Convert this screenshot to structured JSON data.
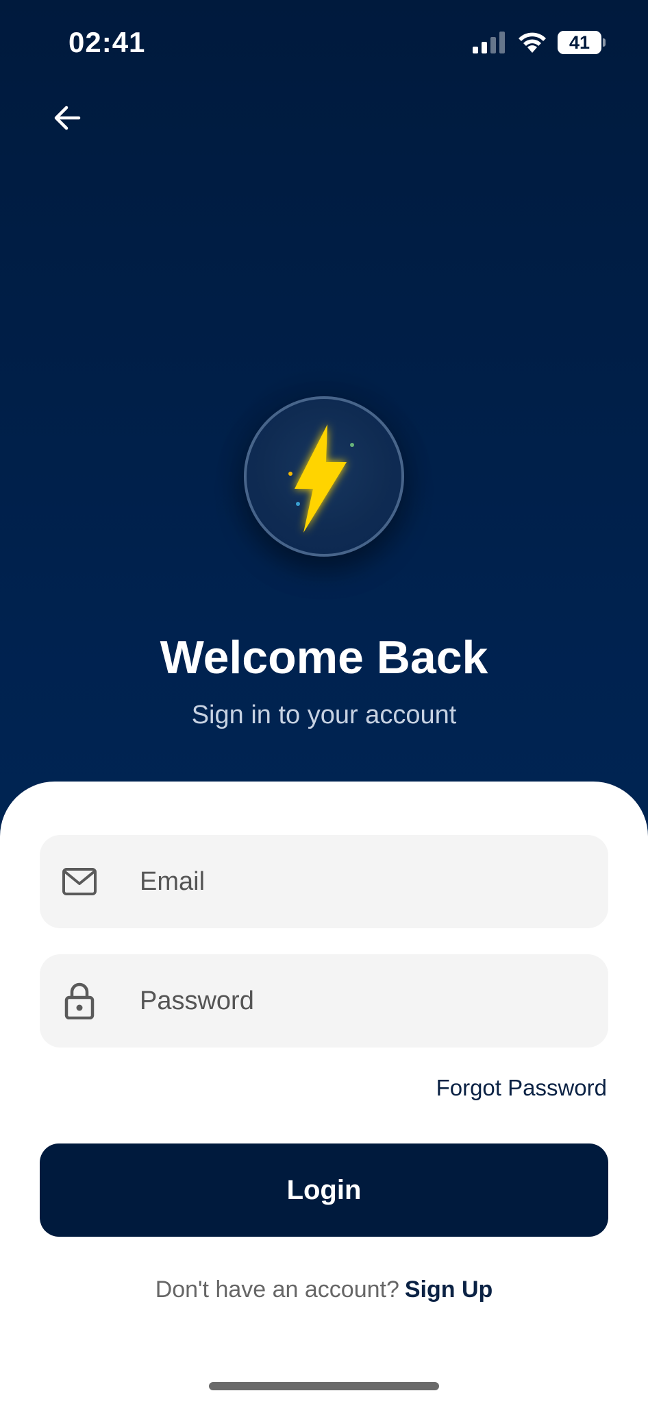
{
  "status_bar": {
    "time": "02:41",
    "battery_level": "41",
    "icons": [
      "signal-icon",
      "wifi-icon",
      "battery-icon"
    ]
  },
  "header": {
    "back_icon": "arrow-left-icon"
  },
  "logo": {
    "icon": "lightning-bolt-icon",
    "bolt_color": "#ffd400"
  },
  "hero": {
    "title": "Welcome Back",
    "subtitle": "Sign in to your account"
  },
  "form": {
    "email": {
      "placeholder": "Email",
      "value": "",
      "icon": "mail-icon"
    },
    "password": {
      "placeholder": "Password",
      "value": "",
      "icon": "lock-icon"
    },
    "forgot_password": "Forgot Password",
    "login_label": "Login",
    "signup_prompt": "Don't have an account?",
    "signup_label": "Sign Up"
  },
  "colors": {
    "background": "#001a3d",
    "primary_button": "#001a3d",
    "accent": "#ffd400",
    "sheet": "#ffffff",
    "input_bg": "#f4f4f4"
  }
}
